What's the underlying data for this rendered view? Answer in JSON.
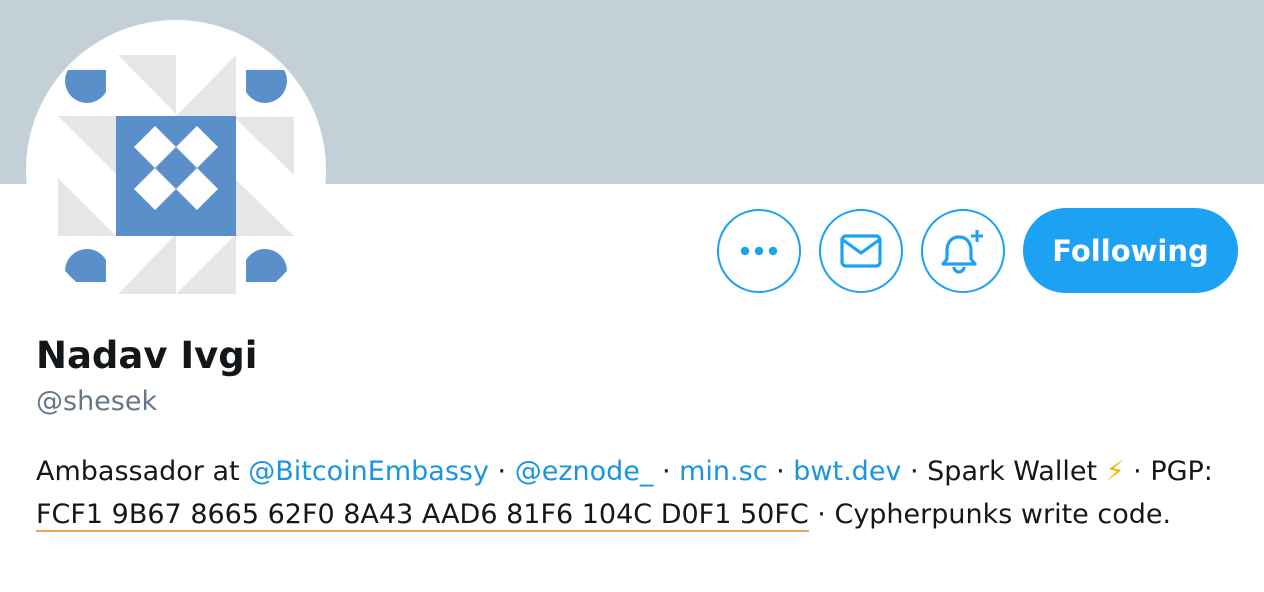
{
  "profile": {
    "name": "Nadav Ivgi",
    "handle": "@shesek"
  },
  "actions": {
    "more_icon": "ellipsis-icon",
    "message_icon": "envelope-icon",
    "notify_icon": "bell-plus-icon",
    "follow_label": "Following"
  },
  "bio": {
    "text_1": "Ambassador at ",
    "link_1": "@BitcoinEmbassy",
    "sep_1": " · ",
    "link_2": "@eznode_",
    "sep_2": " · ",
    "link_3": "min.sc",
    "sep_3": " · ",
    "link_4": "bwt.dev",
    "text_2": " · Spark Wallet ",
    "emoji": "⚡",
    "text_3": " · PGP: ",
    "pgp": "FCF1 9B67 8665 62F0 8A43 AAD6 81F6 104C D0F1 50FC",
    "text_4": " · Cypherpunks write code."
  },
  "colors": {
    "banner": "#c4d0d8",
    "accent": "#1da1f2",
    "link": "#1b95e0",
    "handle": "#657786",
    "pgp_underline": "#f5a55a",
    "avatar_blue": "#5b8fc9",
    "avatar_gray": "#e6e6e6"
  }
}
